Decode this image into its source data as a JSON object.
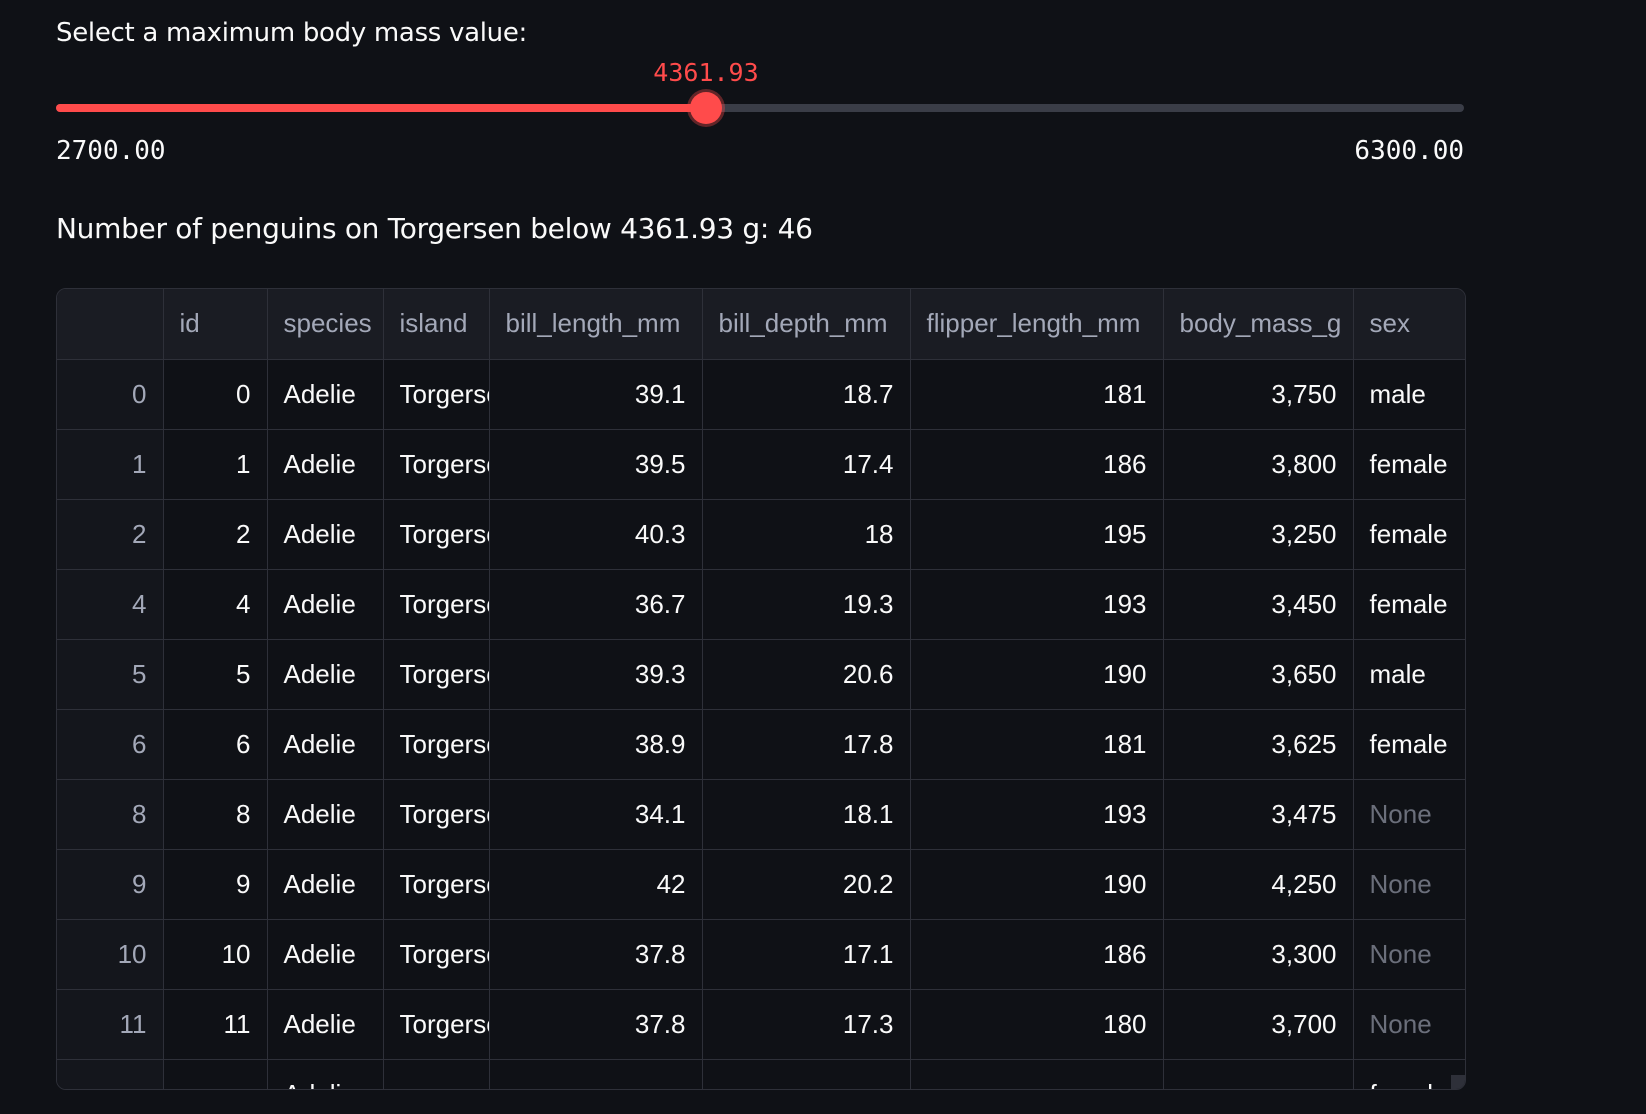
{
  "slider": {
    "label": "Select a maximum body mass value:",
    "value_label": "4361.93",
    "min_label": "2700.00",
    "max_label": "6300.00",
    "value": 4361.93,
    "min": 2700.0,
    "max": 6300.0
  },
  "summary": {
    "text": "Number of penguins on Torgersen below 4361.93 g: 46"
  },
  "table": {
    "columns": [
      "",
      "id",
      "species",
      "island",
      "bill_length_mm",
      "bill_depth_mm",
      "flipper_length_mm",
      "body_mass_g",
      "sex"
    ],
    "rows": [
      {
        "index": "0",
        "id": "0",
        "species": "Adelie",
        "island": "Torgersen",
        "bill_length_mm": "39.1",
        "bill_depth_mm": "18.7",
        "flipper_length_mm": "181",
        "body_mass_g": "3,750",
        "sex": "male"
      },
      {
        "index": "1",
        "id": "1",
        "species": "Adelie",
        "island": "Torgersen",
        "bill_length_mm": "39.5",
        "bill_depth_mm": "17.4",
        "flipper_length_mm": "186",
        "body_mass_g": "3,800",
        "sex": "female"
      },
      {
        "index": "2",
        "id": "2",
        "species": "Adelie",
        "island": "Torgersen",
        "bill_length_mm": "40.3",
        "bill_depth_mm": "18",
        "flipper_length_mm": "195",
        "body_mass_g": "3,250",
        "sex": "female"
      },
      {
        "index": "4",
        "id": "4",
        "species": "Adelie",
        "island": "Torgersen",
        "bill_length_mm": "36.7",
        "bill_depth_mm": "19.3",
        "flipper_length_mm": "193",
        "body_mass_g": "3,450",
        "sex": "female"
      },
      {
        "index": "5",
        "id": "5",
        "species": "Adelie",
        "island": "Torgersen",
        "bill_length_mm": "39.3",
        "bill_depth_mm": "20.6",
        "flipper_length_mm": "190",
        "body_mass_g": "3,650",
        "sex": "male"
      },
      {
        "index": "6",
        "id": "6",
        "species": "Adelie",
        "island": "Torgersen",
        "bill_length_mm": "38.9",
        "bill_depth_mm": "17.8",
        "flipper_length_mm": "181",
        "body_mass_g": "3,625",
        "sex": "female"
      },
      {
        "index": "8",
        "id": "8",
        "species": "Adelie",
        "island": "Torgersen",
        "bill_length_mm": "34.1",
        "bill_depth_mm": "18.1",
        "flipper_length_mm": "193",
        "body_mass_g": "3,475",
        "sex": "None"
      },
      {
        "index": "9",
        "id": "9",
        "species": "Adelie",
        "island": "Torgersen",
        "bill_length_mm": "42",
        "bill_depth_mm": "20.2",
        "flipper_length_mm": "190",
        "body_mass_g": "4,250",
        "sex": "None"
      },
      {
        "index": "10",
        "id": "10",
        "species": "Adelie",
        "island": "Torgersen",
        "bill_length_mm": "37.8",
        "bill_depth_mm": "17.1",
        "flipper_length_mm": "186",
        "body_mass_g": "3,300",
        "sex": "None"
      },
      {
        "index": "11",
        "id": "11",
        "species": "Adelie",
        "island": "Torgersen",
        "bill_length_mm": "37.8",
        "bill_depth_mm": "17.3",
        "flipper_length_mm": "180",
        "body_mass_g": "3,700",
        "sex": "None"
      },
      {
        "index": "",
        "id": "",
        "species": "Adelie",
        "island": "",
        "bill_length_mm": "",
        "bill_depth_mm": "",
        "flipper_length_mm": "",
        "body_mass_g": "",
        "sex": "female"
      }
    ]
  },
  "colors": {
    "accent": "#ff4b4b",
    "background": "#0f1116",
    "track": "#3a3d47",
    "null_text": "#6b6f7b"
  }
}
